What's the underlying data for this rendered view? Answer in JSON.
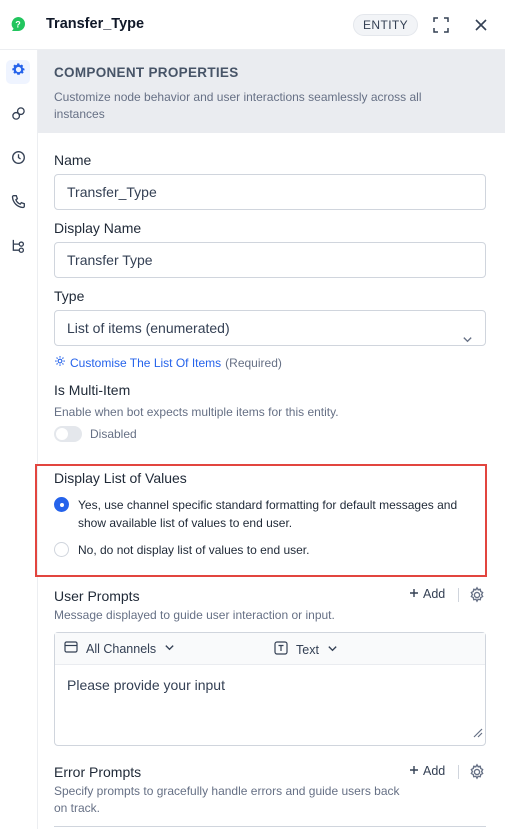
{
  "header": {
    "title": "Transfer_Type",
    "badge": "ENTITY",
    "logo_color": "#22c55e"
  },
  "rail": {
    "items": [
      {
        "icon": "gear-icon",
        "active": true
      },
      {
        "icon": "link-icon",
        "active": false
      },
      {
        "icon": "history-icon",
        "active": false
      },
      {
        "icon": "phone-icon",
        "active": false
      },
      {
        "icon": "flow-icon",
        "active": false
      }
    ]
  },
  "section": {
    "title": "COMPONENT PROPERTIES",
    "description": "Customize node behavior and user interactions seamlessly across all instances"
  },
  "form": {
    "name_label": "Name",
    "name_value": "Transfer_Type",
    "display_name_label": "Display Name",
    "display_name_value": "Transfer Type",
    "type_label": "Type",
    "type_value": "List of items (enumerated)",
    "customise_link": "Customise The List Of Items",
    "required_note": "(Required)",
    "multi_item_label": "Is Multi-Item",
    "multi_item_hint": "Enable when bot expects multiple items for this entity.",
    "toggle_label": "Disabled",
    "toggle_on": false
  },
  "display_list": {
    "title": "Display List of Values",
    "options": [
      {
        "label": "Yes, use channel specific standard formatting for default messages and show available list of values to end user.",
        "selected": true
      },
      {
        "label": "No, do not display list of values to end user.",
        "selected": false
      }
    ],
    "highlight_color": "#e2453f"
  },
  "user_prompts": {
    "title": "User Prompts",
    "description": "Message displayed to guide user interaction or input.",
    "add_label": "Add",
    "channel_select": "All Channels",
    "format_select": "Text",
    "prompt_text": "Please provide your input"
  },
  "error_prompts": {
    "title": "Error Prompts",
    "description": "Specify prompts to gracefully handle errors and guide users back on track.",
    "add_label": "Add"
  },
  "colors": {
    "accent": "#2563eb",
    "section_bg": "#eaecf0"
  }
}
